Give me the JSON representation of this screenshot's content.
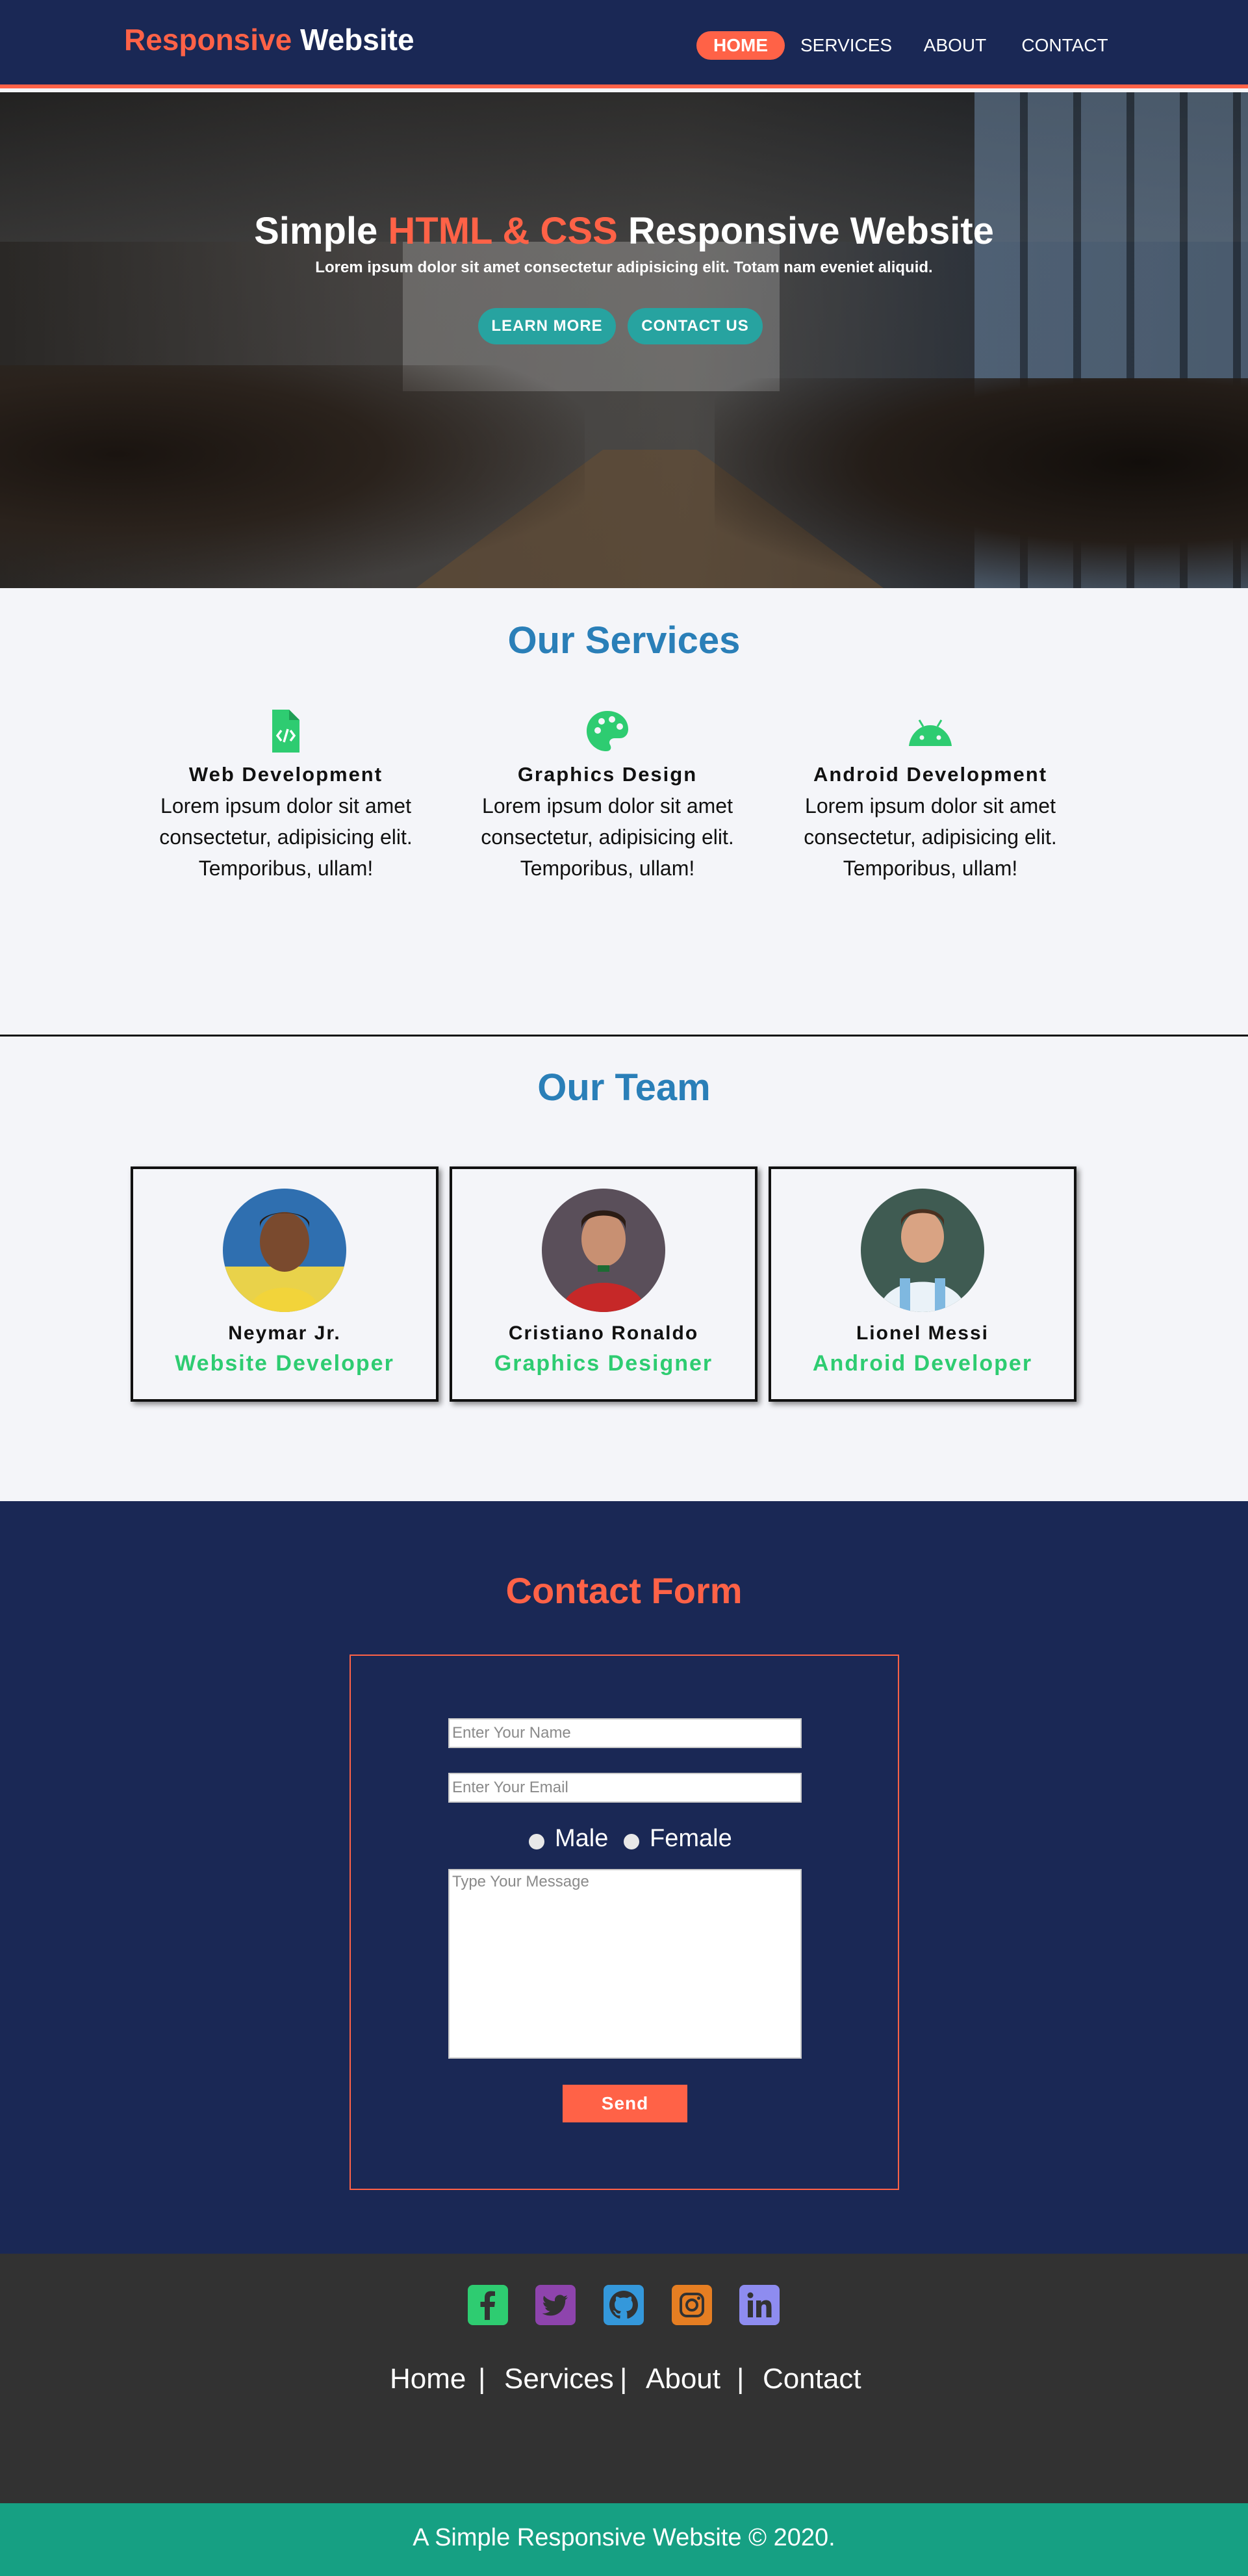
{
  "header": {
    "brand_accent": "Responsive",
    "brand_rest": "Website",
    "nav": [
      {
        "label": "HOME",
        "active": true
      },
      {
        "label": "SERVICES",
        "active": false
      },
      {
        "label": "ABOUT",
        "active": false
      },
      {
        "label": "CONTACT",
        "active": false
      }
    ]
  },
  "hero": {
    "title_pre": "Simple",
    "title_accent": "HTML & CSS",
    "title_post": "Responsive Website",
    "subtitle": "Lorem ipsum dolor sit amet consectetur adipisicing elit. Totam nam eveniet aliquid.",
    "buttons": [
      "LEARN MORE",
      "CONTACT US"
    ]
  },
  "services": {
    "title": "Our Services",
    "items": [
      {
        "name": "Web Development",
        "icon": "file-code-icon",
        "desc": "Lorem ipsum dolor sit amet consectetur, adipisicing elit. Temporibus, ullam!"
      },
      {
        "name": "Graphics Design",
        "icon": "palette-icon",
        "desc": "Lorem ipsum dolor sit amet consectetur, adipisicing elit. Temporibus, ullam!"
      },
      {
        "name": "Android Development",
        "icon": "android-icon",
        "desc": "Lorem ipsum dolor sit amet consectetur, adipisicing elit. Temporibus, ullam!"
      }
    ]
  },
  "team": {
    "title": "Our Team",
    "members": [
      {
        "name": "Neymar Jr.",
        "role": "Website Developer"
      },
      {
        "name": "Cristiano Ronaldo",
        "role": "Graphics Designer"
      },
      {
        "name": "Lionel Messi",
        "role": "Android Developer"
      }
    ]
  },
  "contact": {
    "title": "Contact Form",
    "name_placeholder": "Enter Your Name",
    "email_placeholder": "Enter Your Email",
    "gender_options": [
      "Male",
      "Female"
    ],
    "message_placeholder": "Type Your Message",
    "send_label": "Send"
  },
  "footer": {
    "social": [
      "facebook-icon",
      "twitter-icon",
      "github-icon",
      "instagram-icon",
      "linkedin-icon"
    ],
    "links": [
      "Home",
      "Services",
      "About",
      "Contact"
    ],
    "separator": "|",
    "copyright": "A Simple Responsive Website © 2020."
  },
  "colors": {
    "navy": "#1a2855",
    "accent": "#ff6247",
    "teal_button": "#27a3a0",
    "service_title": "#2a7fb8",
    "green": "#2ecc71",
    "footer_dark": "#323232",
    "footer_bar": "#16a083"
  }
}
